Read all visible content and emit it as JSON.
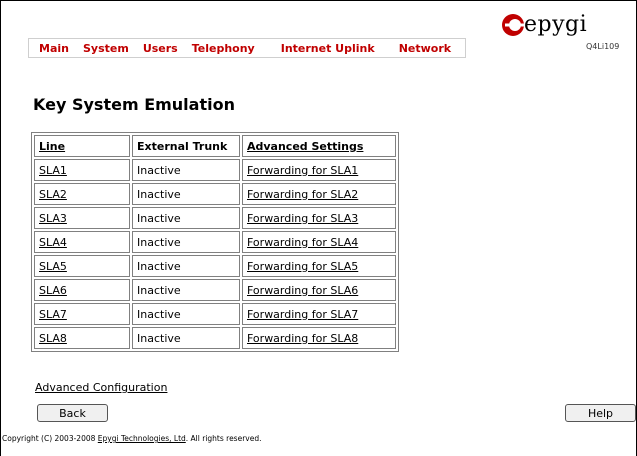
{
  "menu": {
    "items": [
      {
        "id": "main",
        "label": "Main"
      },
      {
        "id": "system",
        "label": "System"
      },
      {
        "id": "users",
        "label": "Users"
      },
      {
        "id": "telephony",
        "label": "Telephony"
      },
      {
        "id": "internet-uplink",
        "label": "Internet Uplink"
      },
      {
        "id": "network",
        "label": "Network"
      }
    ]
  },
  "logo": {
    "word": "epygi",
    "model": "Q4Li109",
    "brand_color": "#c00000"
  },
  "page_title": "Key System Emulation",
  "table": {
    "headers": [
      "Line",
      "External Trunk",
      "Advanced Settings"
    ],
    "rows": [
      {
        "line": "SLA1",
        "trunk": "Inactive",
        "settings": "Forwarding for SLA1"
      },
      {
        "line": "SLA2",
        "trunk": "Inactive",
        "settings": "Forwarding for SLA2"
      },
      {
        "line": "SLA3",
        "trunk": "Inactive",
        "settings": "Forwarding for SLA3"
      },
      {
        "line": "SLA4",
        "trunk": "Inactive",
        "settings": "Forwarding for SLA4"
      },
      {
        "line": "SLA5",
        "trunk": "Inactive",
        "settings": "Forwarding for SLA5"
      },
      {
        "line": "SLA6",
        "trunk": "Inactive",
        "settings": "Forwarding for SLA6"
      },
      {
        "line": "SLA7",
        "trunk": "Inactive",
        "settings": "Forwarding for SLA7"
      },
      {
        "line": "SLA8",
        "trunk": "Inactive",
        "settings": "Forwarding for SLA8"
      }
    ]
  },
  "links": {
    "advanced_configuration": "Advanced Configuration"
  },
  "buttons": {
    "back": "Back",
    "help": "Help"
  },
  "footer": {
    "prefix": "Copyright (C) 2003-2008 ",
    "company": "Epygi Technologies, Ltd",
    "suffix": ". All rights reserved."
  }
}
